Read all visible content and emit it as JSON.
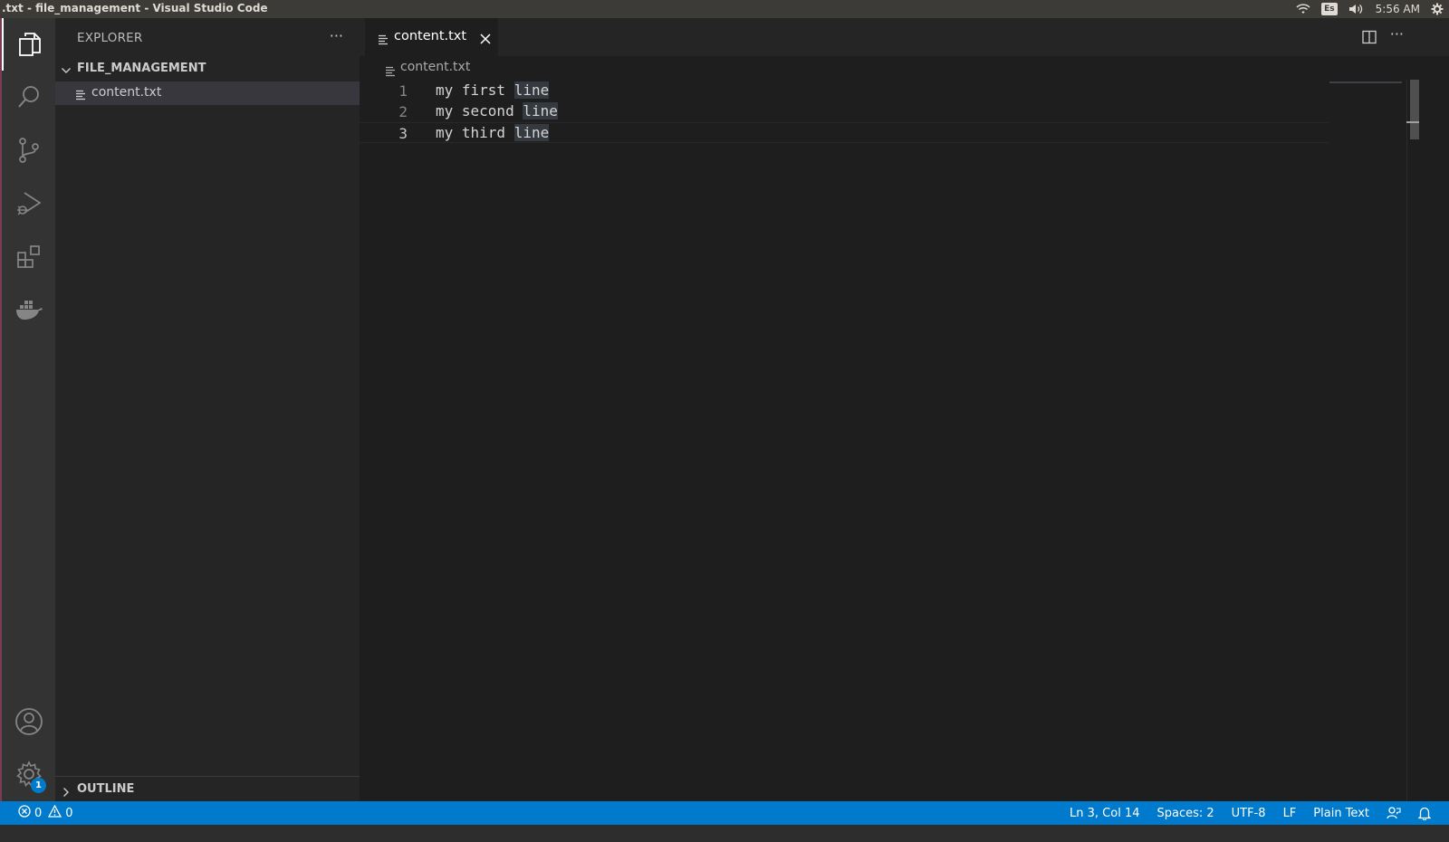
{
  "os": {
    "window_title": ".txt - file_management - Visual Studio Code",
    "keyboard_layout": "Es",
    "time": "5:56 AM"
  },
  "activity_bar": {
    "items": [
      {
        "name": "explorer-icon"
      },
      {
        "name": "search-icon"
      },
      {
        "name": "source-control-icon"
      },
      {
        "name": "run-debug-icon"
      },
      {
        "name": "extensions-icon"
      },
      {
        "name": "docker-icon"
      }
    ],
    "accounts_icon": "accounts-icon",
    "settings_icon": "gear-icon",
    "settings_badge": "1"
  },
  "sidebar": {
    "title": "EXPLORER",
    "more_label": "···",
    "folder": "FILE_MANAGEMENT",
    "files": [
      {
        "name": "content.txt"
      }
    ],
    "outline_label": "OUTLINE"
  },
  "editor": {
    "tab_label": "content.txt",
    "breadcrumb": "content.txt",
    "more_label": "···",
    "lines": [
      {
        "number": "1",
        "prefix": "my first ",
        "word": "line"
      },
      {
        "number": "2",
        "prefix": "my second ",
        "word": "line"
      },
      {
        "number": "3",
        "prefix": "my third ",
        "word": "line"
      }
    ]
  },
  "status_bar": {
    "errors": "0",
    "warnings": "0",
    "position": "Ln 3, Col 14",
    "spaces": "Spaces: 2",
    "encoding": "UTF-8",
    "eol": "LF",
    "language": "Plain Text",
    "accent_color": "#007acc"
  }
}
